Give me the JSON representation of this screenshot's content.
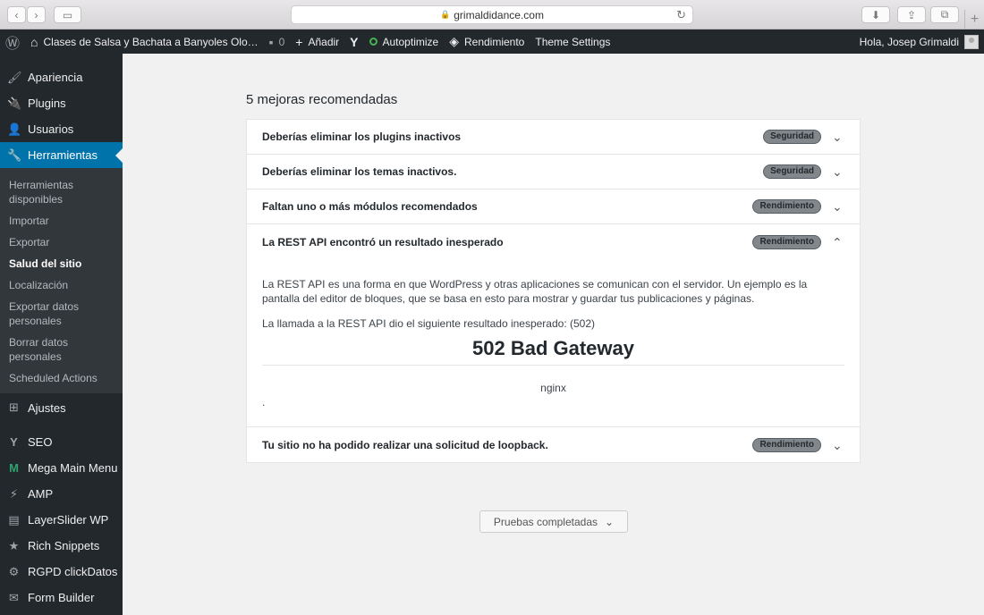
{
  "browser": {
    "url": "grimaldidance.com",
    "lock_icon": "🔒",
    "new_tab": "+"
  },
  "adminbar": {
    "site_name": "Clases de Salsa y Bachata a Banyoles Olo…",
    "comments_count": "0",
    "new_label": "Añadir",
    "autoptimize": "Autoptimize",
    "rendimiento": "Rendimiento",
    "theme_settings": "Theme Settings",
    "greeting": "Hola, Josep Grimaldi"
  },
  "sidebar": {
    "items_top": [
      {
        "label": "Apariencia",
        "icon": "🖌"
      },
      {
        "label": "Plugins",
        "icon": "🔌"
      },
      {
        "label": "Usuarios",
        "icon": "👤"
      }
    ],
    "active": {
      "label": "Herramientas",
      "icon": "🔧"
    },
    "submenu": [
      "Herramientas disponibles",
      "Importar",
      "Exportar",
      "Salud del sitio",
      "Localización",
      "Exportar datos personales",
      "Borrar datos personales",
      "Scheduled Actions"
    ],
    "items_bottom": [
      {
        "label": "Ajustes",
        "icon": "⊞"
      },
      {
        "label": "SEO",
        "icon": "Y"
      },
      {
        "label": "Mega Main Menu",
        "icon": "M"
      },
      {
        "label": "AMP",
        "icon": "⚡"
      },
      {
        "label": "LayerSlider WP",
        "icon": "▤"
      },
      {
        "label": "Rich Snippets",
        "icon": "★"
      },
      {
        "label": "RGPD clickDatos",
        "icon": "⚙"
      },
      {
        "label": "Form Builder",
        "icon": "✉"
      }
    ]
  },
  "main": {
    "section_title": "5 mejoras recomendadas",
    "issues": [
      {
        "title": "Deberías eliminar los plugins inactivos",
        "badge": "Seguridad"
      },
      {
        "title": "Deberías eliminar los temas inactivos.",
        "badge": "Seguridad"
      },
      {
        "title": "Faltan uno o más módulos recomendados",
        "badge": "Rendimiento"
      },
      {
        "title": "La REST API encontró un resultado inesperado",
        "badge": "Rendimiento"
      },
      {
        "title": "Tu sitio no ha podido realizar una solicitud de loopback.",
        "badge": "Rendimiento"
      }
    ],
    "expanded": {
      "description": "La REST API es una forma en que WordPress y otras aplicaciones se comunican con el servidor. Un ejemplo es la pantalla del editor de bloques, que se basa en esto para mostrar y guardar tus publicaciones y páginas.",
      "result_line": "La llamada a la REST API dio el siguiente resultado inesperado: (502)",
      "error_heading": "502 Bad Gateway",
      "server": "nginx",
      "trailing": "."
    },
    "tests_button": "Pruebas completadas"
  }
}
